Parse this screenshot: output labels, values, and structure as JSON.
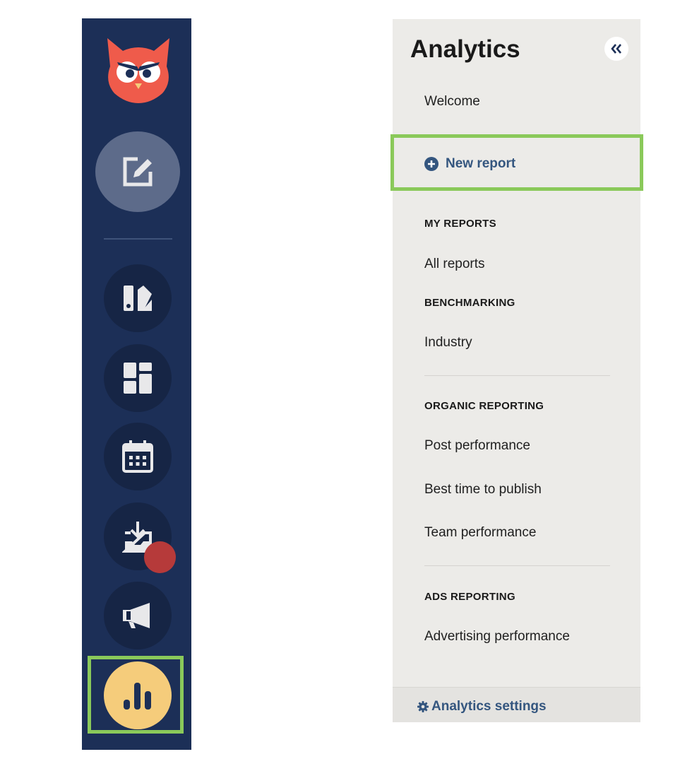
{
  "colors": {
    "rail_bg": "#1c2f57",
    "accent_green": "#8ac95a",
    "link_blue": "#34567f",
    "analytics_yellow": "#f5cc7b",
    "notification_red": "#b63a3a",
    "owl_red": "#ef5b4b"
  },
  "rail": {
    "items": [
      {
        "icon": "owl-logo-icon"
      },
      {
        "icon": "compose-icon"
      },
      {
        "icon": "streams-icon"
      },
      {
        "icon": "dashboard-icon"
      },
      {
        "icon": "calendar-icon"
      },
      {
        "icon": "inbox-icon"
      },
      {
        "icon": "megaphone-icon"
      },
      {
        "icon": "bar-chart-icon"
      }
    ]
  },
  "panel": {
    "title": "Analytics",
    "welcome": "Welcome",
    "new_report": "New report",
    "my_reports_heading": "MY REPORTS",
    "all_reports": "All reports",
    "benchmarking_heading": "BENCHMARKING",
    "industry": "Industry",
    "organic_heading": "ORGANIC REPORTING",
    "post_performance": "Post performance",
    "best_time": "Best time to publish",
    "team_performance": "Team performance",
    "ads_heading": "ADS REPORTING",
    "advertising_performance": "Advertising performance",
    "settings": "Analytics settings"
  }
}
